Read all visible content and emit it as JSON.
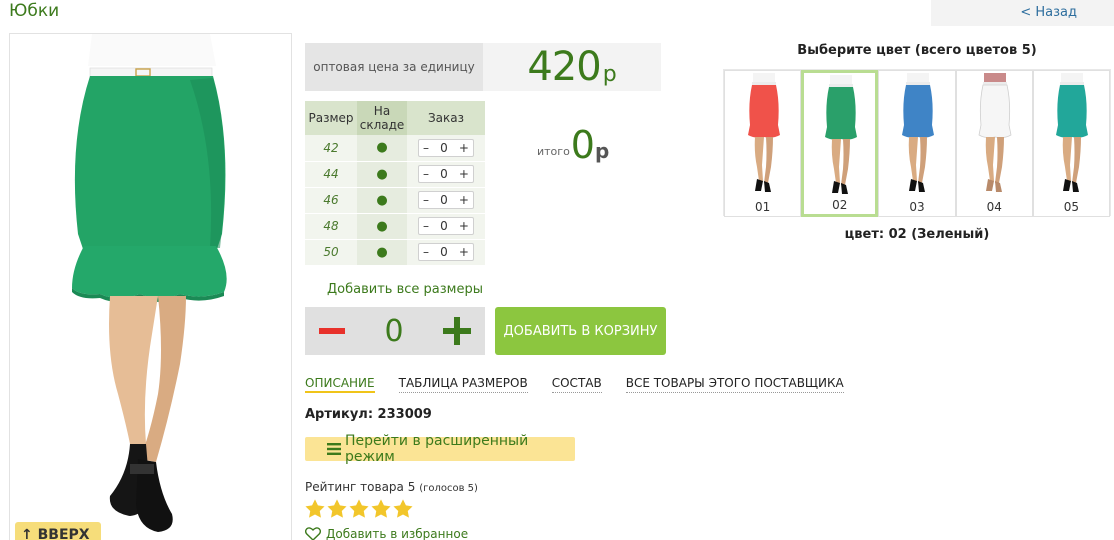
{
  "header": {
    "title": "Юбки",
    "back_label": "< Назад"
  },
  "price": {
    "label": "оптовая цена за единицу",
    "value": "420",
    "currency": "р"
  },
  "size_table": {
    "headers": {
      "size": "Размер",
      "stock": "На складе",
      "order": "Заказ"
    },
    "rows": [
      {
        "size": "42",
        "stock": "●",
        "qty": "0"
      },
      {
        "size": "44",
        "stock": "●",
        "qty": "0"
      },
      {
        "size": "46",
        "stock": "●",
        "qty": "0"
      },
      {
        "size": "48",
        "stock": "●",
        "qty": "0"
      },
      {
        "size": "50",
        "stock": "●",
        "qty": "0"
      }
    ],
    "minus": "–",
    "plus": "+"
  },
  "total": {
    "label": "итого",
    "value": "0",
    "currency": "р"
  },
  "add_all_sizes": "Добавить все размеры",
  "quantity": {
    "value": "0"
  },
  "add_to_cart": "ДОБАВИТЬ В КОРЗИНУ",
  "tabs": [
    "ОПИСАНИЕ",
    "ТАБЛИЦА РАЗМЕРОВ",
    "СОСТАВ",
    "ВСЕ ТОВАРЫ ЭТОГО ПОСТАВЩИКА"
  ],
  "sku": "Артикул: 233009",
  "advanced_mode": "Перейти в расширенный режим",
  "rating": {
    "label": "Рейтинг товара 5",
    "votes": "(голосов 5)",
    "stars": 5
  },
  "favorite": "Добавить в избранное",
  "up_button": "ВВЕРХ",
  "colors": {
    "title": "Выберите цвет (всего цветов 5)",
    "swatches": [
      {
        "label": "01",
        "color": "#f0524a"
      },
      {
        "label": "02",
        "color": "#2aa06a"
      },
      {
        "label": "03",
        "color": "#3f84c6"
      },
      {
        "label": "04",
        "color": "#f6f6f6"
      },
      {
        "label": "05",
        "color": "#22a79a"
      }
    ],
    "selected_text": "цвет: 02 (Зеленый)"
  },
  "theme": {
    "accent": "#3c7a1c",
    "button_green": "#8cc63f",
    "highlight_yellow": "#fbe495"
  }
}
